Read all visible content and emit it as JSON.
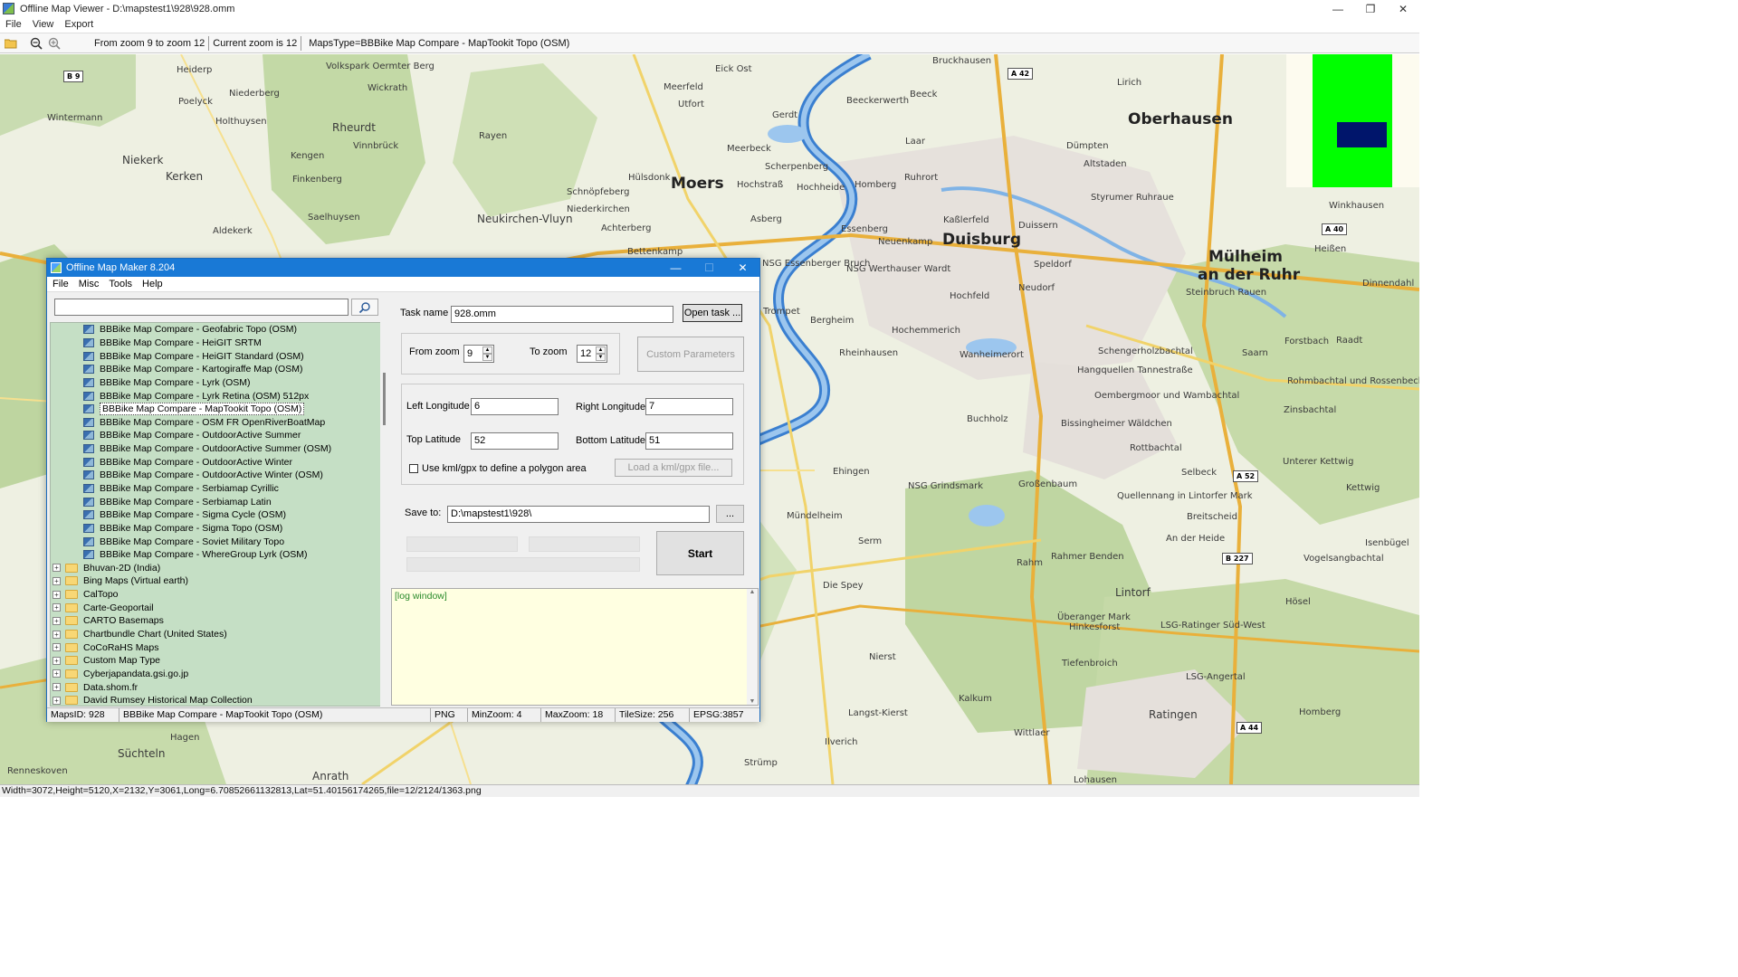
{
  "window": {
    "title": "Offline Map Viewer - D:\\mapstest1\\928\\928.omm",
    "menu": [
      "File",
      "View",
      "Export"
    ],
    "controls": {
      "minimize": "—",
      "restore": "❐",
      "close": "✕"
    }
  },
  "toolbar": {
    "zoom_range": "From zoom 9 to zoom 12",
    "current_zoom": "Current zoom is 12",
    "maps_type": "MapsType=BBBike Map Compare - MapTookit Topo (OSM)"
  },
  "map": {
    "cities": [
      {
        "name": "Oberhausen",
        "size": 17
      },
      {
        "name": "Moers",
        "size": 17
      },
      {
        "name": "Duisburg",
        "size": 17
      },
      {
        "name": "Mülheim",
        "size": 17
      },
      {
        "name": "an der Ruhr",
        "size": 17
      }
    ],
    "towns": [
      "Heiderp",
      "Volkspark Oermter Berg",
      "Eick Ost",
      "Bruckhausen",
      "Wintermann",
      "Poelyck",
      "Rheurdt",
      "Vinnbrück",
      "Wickrath",
      "Rayen",
      "Meerfeld",
      "Beeckerwerth",
      "Beeck",
      "Lirich",
      "Niederberg",
      "Holthuysen",
      "Utfort",
      "Gerdt",
      "Niekerk",
      "Kerken",
      "Kengen",
      "Meerbeck",
      "Laar",
      "Dümpten",
      "Finkenberg",
      "Hülsdonk",
      "Hochstraß",
      "Scherpenberg",
      "Schnöpfeberg",
      "Altstaden",
      "Hochheide",
      "Homberg",
      "Ruhrort",
      "Aldekerk",
      "Saelhuysen",
      "Neukirchen-Vluyn",
      "Niederkirchen",
      "Asberg",
      "Achterberg",
      "Kaßlerfeld",
      "Duissern",
      "Styrumer Ruhraue",
      "Bettenkamp",
      "Essenberg",
      "Neuenkamp",
      "Speldorf",
      "NSG Essenberger Bruch",
      "NSG Werthauser Wardt",
      "Hochfeld",
      "Neudorf",
      "Steinbruch Rauen",
      "Trompet",
      "Bergheim",
      "Hochemmerich",
      "Schengerholzbachtal",
      "Rheinhausen",
      "Saarn",
      "Forstbach",
      "Raadt",
      "Wanheimerort",
      "Hangquellen Tannestraße",
      "Oembergmoor und Wambachtal",
      "Rohmbachtal und Rossenbecktal",
      "Buchholz",
      "Bissingheimer Wäldchen",
      "Zinsbachtal",
      "Ehingen",
      "Rottbachtal",
      "Selbeck",
      "NSG Grindsmark",
      "Unterer Kettwig",
      "Mündelheim",
      "Großenbaum",
      "Quellennang in Lintorfer Mark",
      "Breitscheid",
      "Kettwig",
      "Serm",
      "Rahm",
      "An der Heide",
      "Isenbügel",
      "Rahmer Benden",
      "Vogelsangbachtal",
      "Die Spey",
      "Lintorf",
      "Hösel",
      "Überanger Mark",
      "Hinkesforst",
      "LSG-Ratinger Süd-West",
      "Nierst",
      "Tiefenbroich",
      "LSG-Angertal",
      "Kalkum",
      "Langst-Kierst",
      "Ratingen",
      "Homberg",
      "Ilverich",
      "Süchteln",
      "Hagen",
      "Anrath",
      "Strümp",
      "Lohausen",
      "Renneskoven",
      "Wittlaer",
      "Winkhausen",
      "Heißen",
      "Dinnendahl"
    ],
    "road_badges": [
      "B 9",
      "A 42",
      "A 40",
      "A 52",
      "B 227",
      "A 44"
    ]
  },
  "statusbar": "Width=3072,Height=5120,X=2132,Y=3061,Long=6.70852661132813,Lat=51.40156174265,file=12/2124/1363.png",
  "dialog": {
    "title": "Offline Map Maker 8.204",
    "menu": [
      "File",
      "Misc",
      "Tools",
      "Help"
    ],
    "controls": {
      "minimize": "—",
      "maximize": "☐",
      "close": "✕"
    },
    "search_value": "",
    "tree_children": [
      "BBBike Map Compare - Geofabric Topo (OSM)",
      "BBBike Map Compare - HeiGIT SRTM",
      "BBBike Map Compare - HeiGIT Standard (OSM)",
      "BBBike Map Compare - Kartogiraffe Map (OSM)",
      "BBBike Map Compare - Lyrk (OSM)",
      "BBBike Map Compare - Lyrk Retina (OSM) 512px",
      "BBBike Map Compare - MapTookit Topo (OSM)",
      "BBBike Map Compare - OSM FR OpenRiverBoatMap",
      "BBBike Map Compare - OutdoorActive Summer",
      "BBBike Map Compare - OutdoorActive Summer (OSM)",
      "BBBike Map Compare - OutdoorActive Winter",
      "BBBike Map Compare - OutdoorActive Winter (OSM)",
      "BBBike Map Compare - Serbiamap Cyrillic",
      "BBBike Map Compare - Serbiamap Latin",
      "BBBike Map Compare - Sigma Cycle (OSM)",
      "BBBike Map Compare - Sigma Topo (OSM)",
      "BBBike Map Compare - Soviet Military Topo",
      "BBBike Map Compare - WhereGroup Lyrk (OSM)"
    ],
    "selected_index": 6,
    "tree_folders": [
      "Bhuvan-2D (India)",
      "Bing Maps (Virtual earth)",
      "CalTopo",
      "Carte-Geoportail",
      "CARTO Basemaps",
      "Chartbundle Chart (United States)",
      "CoCoRaHS Maps",
      "Custom Map Type",
      "Cyberjapandata.gsi.go.jp",
      "Data.shom.fr",
      "David Rumsey Historical Map Collection"
    ],
    "task_name_label": "Task name",
    "task_name_value": "928.omm",
    "open_task_label": "Open task ...",
    "from_zoom_label": "From zoom",
    "from_zoom_value": "9",
    "to_zoom_label": "To zoom",
    "to_zoom_value": "12",
    "custom_params_label": "Custom Parameters",
    "left_lon_label": "Left Longitude",
    "left_lon_value": "6",
    "right_lon_label": "Right Longitude",
    "right_lon_value": "7",
    "top_lat_label": "Top Latitude",
    "top_lat_value": "52",
    "bottom_lat_label": "Bottom Latitude",
    "bottom_lat_value": "51",
    "kml_checkbox_label": "Use kml/gpx to define a polygon area",
    "load_kml_label": "Load a kml/gpx file...",
    "save_to_label": "Save to:",
    "save_to_value": "D:\\mapstest1\\928\\",
    "browse_label": "...",
    "start_label": "Start",
    "log_text": "[log window]",
    "status": {
      "maps_id": "MapsID: 928",
      "maps_name": "BBBike Map Compare - MapTookit Topo (OSM)",
      "format": "PNG",
      "min_zoom": "MinZoom: 4",
      "max_zoom": "MaxZoom: 18",
      "tile_size": "TileSize: 256",
      "epsg": "EPSG:3857"
    }
  },
  "colors": {
    "dialog_title": "#1979d6",
    "tree_bg": "#c5dfc5",
    "log_bg": "#ffffe1",
    "overview_green": "#00ff00",
    "overview_blue": "#00156b",
    "river": "#3a7fd0"
  }
}
